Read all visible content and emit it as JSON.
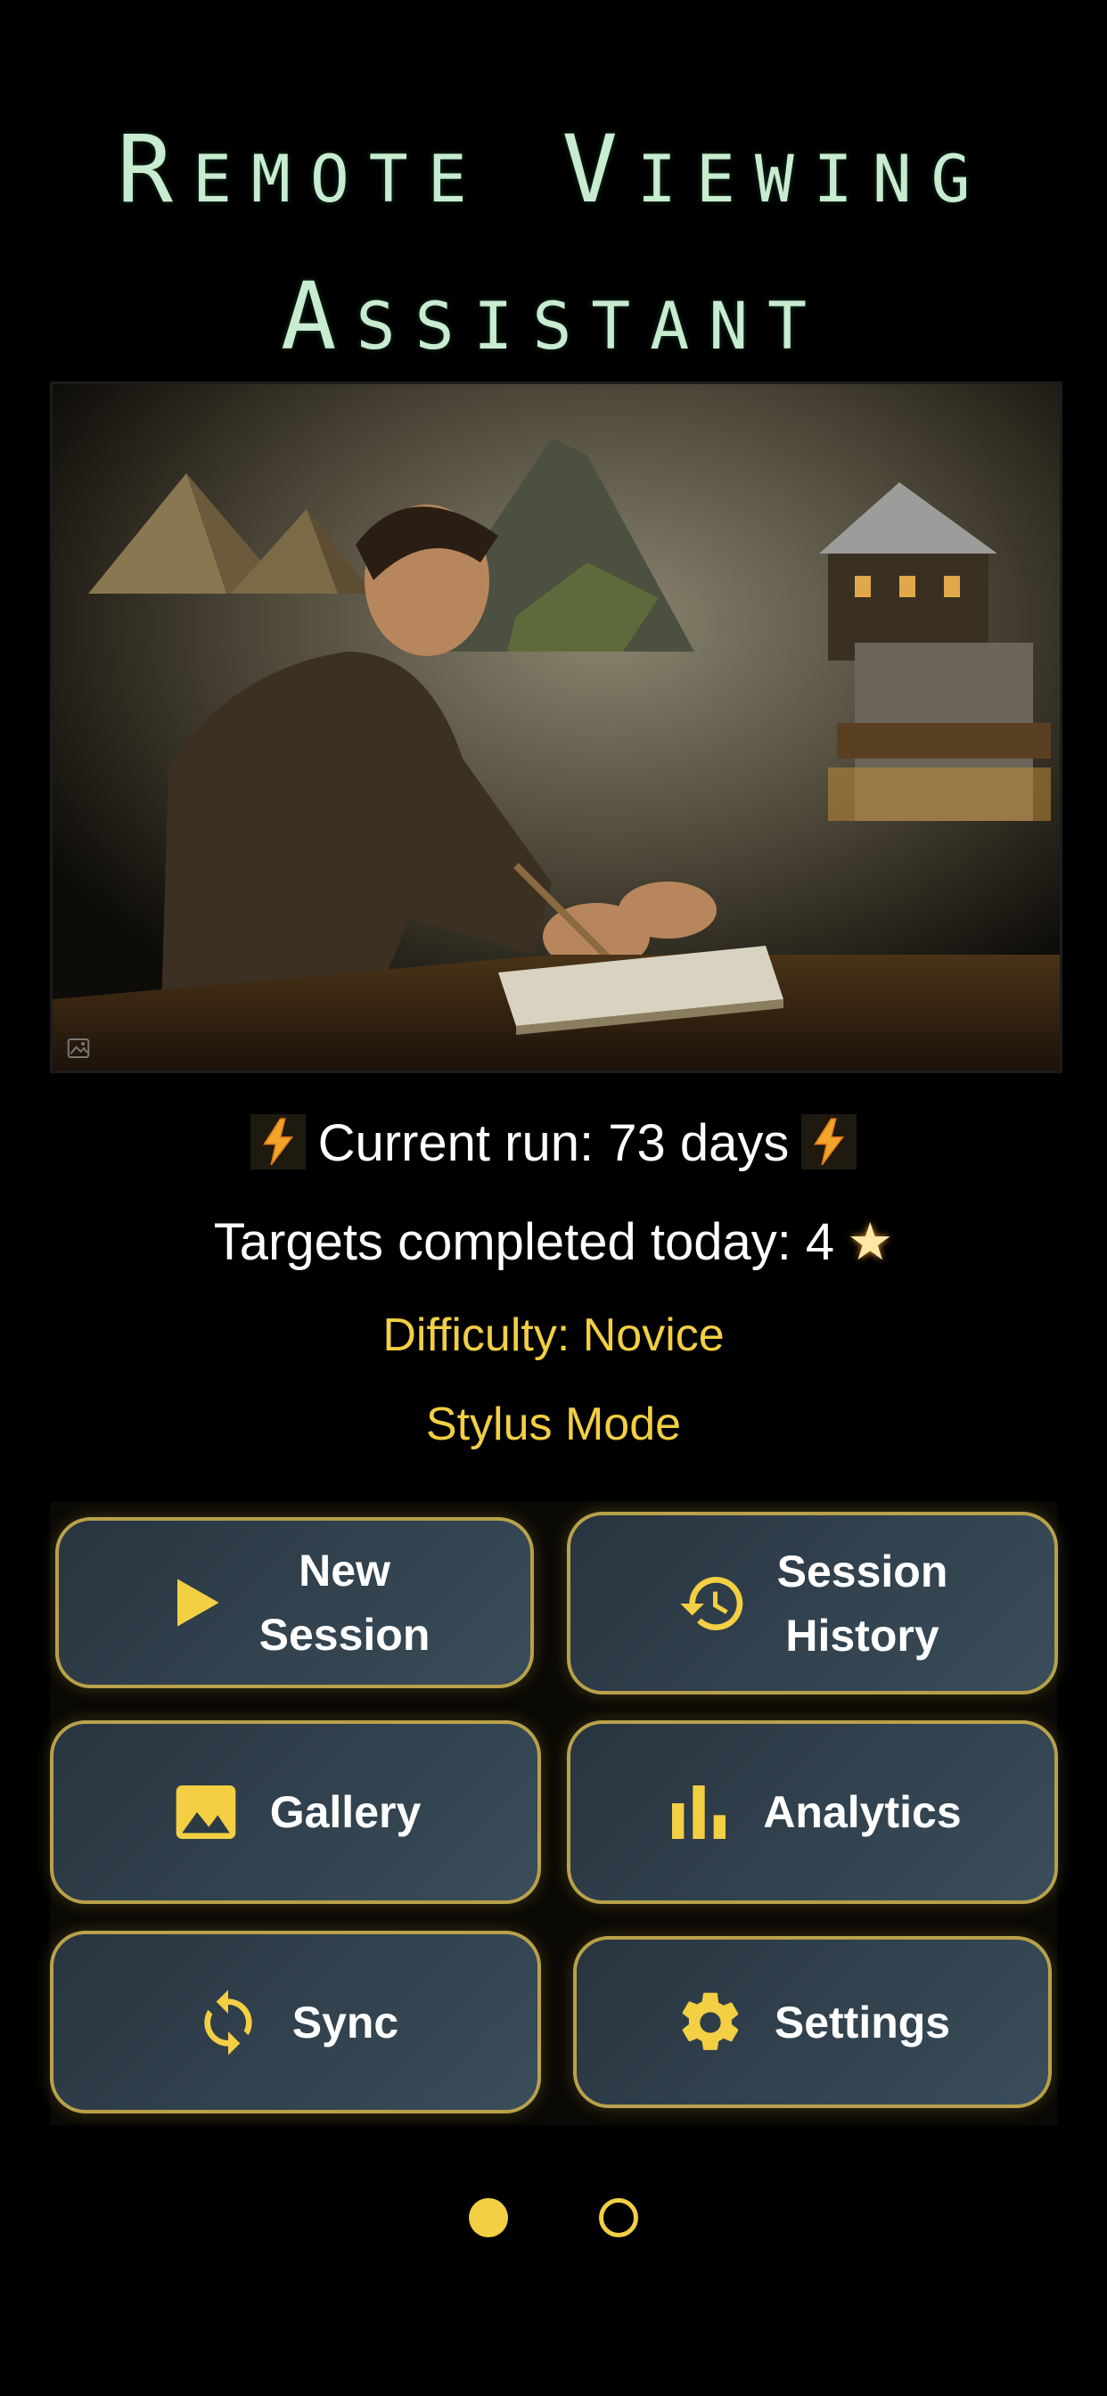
{
  "header": {
    "title_line1": "Remote Viewing",
    "title_line2": "Assistant"
  },
  "hero": {
    "image_alt": "Man drawing in a notebook, dreaming of pyramids, mountain ruins and a village",
    "corner_icon": "image-icon"
  },
  "stats": {
    "run_text": "Current run: 73 days",
    "run_icon": "lightning-bolt-icon",
    "targets_text": "Targets completed today: 4",
    "targets_icon": "star-icon",
    "difficulty": "Difficulty: Novice",
    "mode": "Stylus Mode"
  },
  "menu": {
    "new_session": {
      "label": "New\nSession",
      "icon": "play-icon"
    },
    "session_history": {
      "label": "Session\nHistory",
      "icon": "history-icon"
    },
    "gallery": {
      "label": "Gallery",
      "icon": "image-icon"
    },
    "analytics": {
      "label": "Analytics",
      "icon": "bar-chart-icon"
    },
    "sync": {
      "label": "Sync",
      "icon": "sync-icon"
    },
    "settings": {
      "label": "Settings",
      "icon": "gear-icon"
    }
  },
  "pager": {
    "pages": 2,
    "current": 1
  },
  "colors": {
    "background": "#000000",
    "title": "#c8ecd0",
    "accent": "#f2cf43",
    "button_border": "#b8a14a",
    "button_fill": "#314350"
  }
}
